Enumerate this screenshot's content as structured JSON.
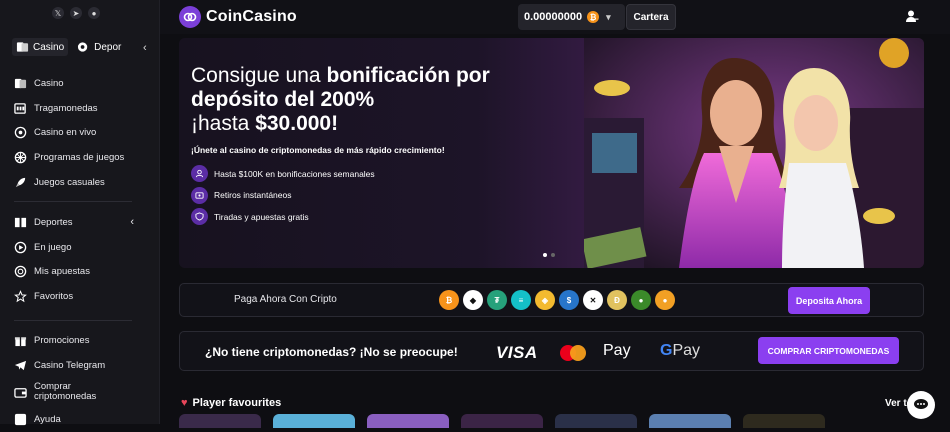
{
  "brand": {
    "name": "CoinCasino"
  },
  "wallet": {
    "balance": "0.00000000",
    "currency_icon": "bitcoin-icon"
  },
  "topbar": {
    "cartera_label": "Cartera"
  },
  "sidebar": {
    "switch": [
      {
        "label": "Casino",
        "active": true
      },
      {
        "label": "Depor",
        "active": false
      }
    ],
    "casino_items": [
      {
        "label": "Casino",
        "icon": "cards-icon"
      },
      {
        "label": "Tragamonedas",
        "icon": "slot-machine-icon"
      },
      {
        "label": "Casino en vivo",
        "icon": "live-icon"
      },
      {
        "label": "Programas de juegos",
        "icon": "wheel-icon"
      },
      {
        "label": "Juegos casuales",
        "icon": "rocket-icon"
      }
    ],
    "sports_items": [
      {
        "label": "Deportes",
        "icon": "ball-icon"
      },
      {
        "label": "En juego",
        "icon": "play-icon"
      },
      {
        "label": "Mis apuestas",
        "icon": "coin-icon"
      },
      {
        "label": "Favoritos",
        "icon": "star-icon"
      }
    ],
    "other_items": [
      {
        "label": "Promociones",
        "icon": "gift-icon"
      },
      {
        "label": "Casino Telegram",
        "icon": "telegram-icon"
      },
      {
        "label": "Comprar criptomonedas",
        "icon": "wallet-icon"
      },
      {
        "label": "Ayuda",
        "icon": "help-icon"
      }
    ]
  },
  "hero": {
    "line1_a": "Consigue una ",
    "line1_b": "bonificación por",
    "line2": "depósito del 200%",
    "line3_a": "¡hasta ",
    "line3_b": "$30.000!",
    "tagline": "¡Únete al casino de criptomonedas de más rápido crecimiento!",
    "bullets": [
      {
        "text": "Hasta $100K en bonificaciones semanales",
        "icon": "users-icon"
      },
      {
        "text": "Retiros instantáneos",
        "icon": "cash-icon"
      },
      {
        "text": "Tiradas y apuestas gratis",
        "icon": "shield-icon"
      }
    ]
  },
  "paybar": {
    "label": "Paga Ahora Con Cripto",
    "coins": [
      {
        "name": "bitcoin",
        "color": "#f7931a",
        "glyph": "₿"
      },
      {
        "name": "ethereum",
        "color": "#ffffff",
        "glyph": "◆"
      },
      {
        "name": "tether",
        "color": "#26a17b",
        "glyph": "₮"
      },
      {
        "name": "solana",
        "color": "#14c0c8",
        "glyph": "≡"
      },
      {
        "name": "bnb",
        "color": "#f3ba2f",
        "glyph": "◈"
      },
      {
        "name": "usdc",
        "color": "#2775ca",
        "glyph": "$"
      },
      {
        "name": "xrp",
        "color": "#ffffff",
        "glyph": "✕"
      },
      {
        "name": "dogecoin",
        "color": "#e1c25f",
        "glyph": "Ð"
      },
      {
        "name": "pepe",
        "color": "#3b8a2a",
        "glyph": "●"
      },
      {
        "name": "shiba",
        "color": "#f2a024",
        "glyph": "●"
      }
    ],
    "button": "Deposita Ahora"
  },
  "no_crypto": {
    "label": "¿No tiene criptomonedas? ¡No se preocupe!",
    "visa": "VISA",
    "apple_pay": "Pay",
    "google_pay": "Pay",
    "button": "COMPRAR CRIPTOMONEDAS"
  },
  "favourites": {
    "title": "Player favourites",
    "see_all": "Ver to"
  }
}
